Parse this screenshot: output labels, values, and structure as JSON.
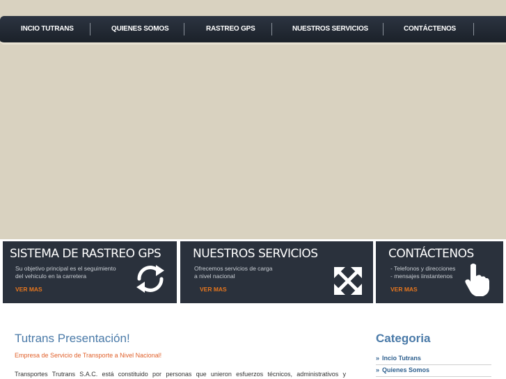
{
  "nav": {
    "items": [
      {
        "label": "INCIO TUTRANS"
      },
      {
        "label": "QUIENES SOMOS"
      },
      {
        "label": "RASTREO GPS"
      },
      {
        "label": "NUESTROS SERVICIOS"
      },
      {
        "label": "CONTÁCTENOS"
      }
    ]
  },
  "panels": [
    {
      "title": "SISTEMA DE RASTREO GPS",
      "desc_lines": [
        "Su objetivo principal es el seguimiento",
        "del vehiculo en la  carretera"
      ],
      "link": "VER MAS",
      "icon": "refresh-icon"
    },
    {
      "title": "NUESTROS SERVICIOS",
      "desc_lines": [
        "Ofrecemos servicios de carga",
        "a nivel nacional"
      ],
      "link": "VER MAS",
      "icon": "expand-arrows-icon"
    },
    {
      "title": "CONTÁCTENOS",
      "desc_lines": [
        "- Telefonos y direcciones",
        "- mensajes iinstantenos"
      ],
      "link": "VER MAS",
      "icon": "hand-pointer-icon"
    }
  ],
  "content": {
    "title": "Tutrans Presentación!",
    "subtitle": "Empresa de Servicio de Transporte a Nivel Nacional!",
    "body": "Transportes Trutrans S.A.C. está constituido por personas  que unieron esfuerzos técnicos, administrativos y"
  },
  "sidebar": {
    "title": "Categoria",
    "arrow": "»",
    "items": [
      {
        "label": "Incio Tutrans"
      },
      {
        "label": "Quienes Somos"
      }
    ]
  },
  "colors": {
    "background_band": "#d9d2c0",
    "nav": "#1f252e",
    "panel": "#2a313c",
    "accent_orange": "#e6761e",
    "title_blue": "#4a7aa8",
    "link_blue": "#2d5f8e"
  }
}
